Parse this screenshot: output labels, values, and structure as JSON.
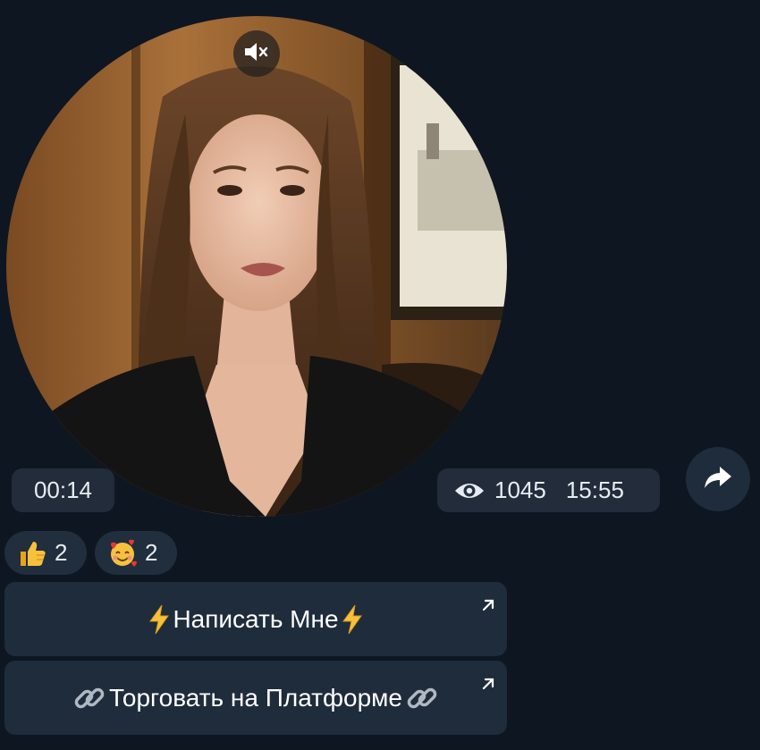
{
  "video_message": {
    "duration": "00:14",
    "muted": true,
    "views": "1045",
    "time": "15:55"
  },
  "reactions": [
    {
      "emoji": "thumbs-up",
      "count": "2"
    },
    {
      "emoji": "smiling-face-with-hearts",
      "count": "2"
    }
  ],
  "inline_keyboard": [
    {
      "label": "Написать Мне",
      "prefix_icon": "lightning",
      "suffix_icon": "lightning"
    },
    {
      "label": "Торговать на Платформе",
      "prefix_icon": "link",
      "suffix_icon": "link"
    }
  ],
  "colors": {
    "background": "#0e1621",
    "button_bg": "#1f2c3b",
    "text": "#e7ecf2"
  }
}
